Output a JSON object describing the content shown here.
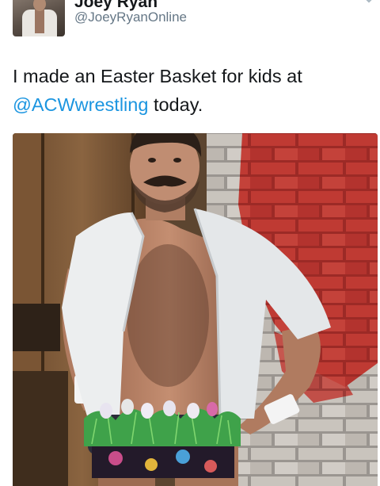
{
  "tweet": {
    "display_name": "Joey Ryan",
    "handle": "@JoeyRyanOnline",
    "text_before": "I made an Easter Basket for kids at ",
    "mention": "@ACWwrestling",
    "text_after": " today."
  },
  "icons": {
    "avatar": "profile-photo",
    "menu": "chevron-down-icon"
  },
  "colors": {
    "name": "#14171a",
    "handle": "#657786",
    "mention": "#1b95e0",
    "brick_red": "#b8322e",
    "shirt_white": "#eceeef",
    "grass_green": "#3fa24a"
  }
}
